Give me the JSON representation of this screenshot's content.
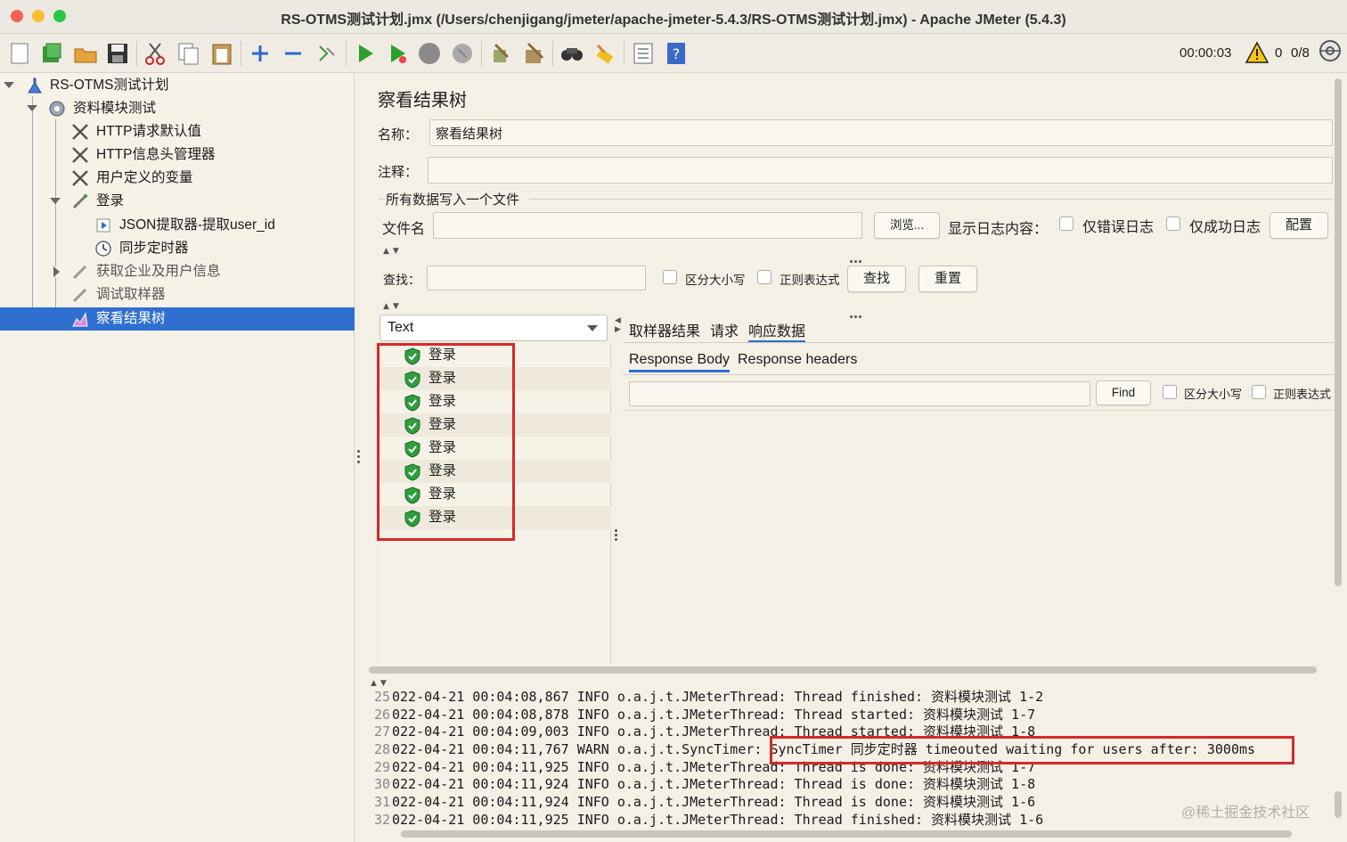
{
  "window": {
    "title": "RS-OTMS测试计划.jmx (/Users/chenjigang/jmeter/apache-jmeter-5.4.3/RS-OTMS测试计划.jmx) - Apache JMeter (5.4.3)"
  },
  "status": {
    "elapsed": "00:00:03",
    "warnings": "0",
    "threads": "0/8"
  },
  "tree": {
    "items": [
      {
        "label": "RS-OTMS测试计划",
        "icon": "test-plan-icon"
      },
      {
        "label": "资料模块测试",
        "icon": "thread-group-icon"
      },
      {
        "label": "HTTP请求默认值",
        "icon": "config-wrench-icon"
      },
      {
        "label": "HTTP信息头管理器",
        "icon": "config-wrench-icon"
      },
      {
        "label": "用户定义的变量",
        "icon": "config-wrench-icon"
      },
      {
        "label": "登录",
        "icon": "sampler-pen-icon"
      },
      {
        "label": "JSON提取器-提取user_id",
        "icon": "extractor-icon"
      },
      {
        "label": "同步定时器",
        "icon": "timer-icon"
      },
      {
        "label": "获取企业及用户信息",
        "icon": "sampler-pen-icon"
      },
      {
        "label": "调试取样器",
        "icon": "sampler-pen-icon"
      },
      {
        "label": "察看结果树",
        "icon": "listener-chart-icon"
      }
    ],
    "selected": "察看结果树"
  },
  "panel": {
    "title": "察看结果树",
    "name_label": "名称：",
    "name_value": "察看结果树",
    "comment_label": "注释：",
    "comment_value": "",
    "file_group_title": "所有数据写入一个文件",
    "filename_label": "文件名",
    "filename_value": "",
    "browse_button": "浏览...",
    "log_content_label": "显示日志内容：",
    "errors_only_label": "仅错误日志",
    "success_only_label": "仅成功日志",
    "configure_button": "配置",
    "search_label": "查找：",
    "search_value": "",
    "case_sensitive_label": "区分大小写",
    "regex_label": "正则表达式",
    "search_button": "查找",
    "reset_button": "重置",
    "renderer": "Text"
  },
  "results": {
    "items": [
      "登录",
      "登录",
      "登录",
      "登录",
      "登录",
      "登录",
      "登录",
      "登录"
    ]
  },
  "detail": {
    "tabs": [
      "取样器结果",
      "请求",
      "响应数据"
    ],
    "active_tab": "响应数据",
    "subtabs": [
      "Response Body",
      "Response headers"
    ],
    "active_subtab": "Response Body",
    "find_value": "",
    "find_button": "Find",
    "case_sensitive_label": "区分大小写",
    "regex_label": "正则表达式"
  },
  "log": {
    "lines": [
      {
        "n": "25",
        "text": "022-04-21 00:04:08,867 INFO o.a.j.t.JMeterThread: Thread finished: 资料模块测试 1-2"
      },
      {
        "n": "26",
        "text": "022-04-21 00:04:08,878 INFO o.a.j.t.JMeterThread: Thread started: 资料模块测试 1-7"
      },
      {
        "n": "27",
        "text": "022-04-21 00:04:09,003 INFO o.a.j.t.JMeterThread: Thread started: 资料模块测试 1-8"
      },
      {
        "n": "28",
        "text": "022-04-21 00:04:11,767 WARN o.a.j.t.SyncTimer: SyncTimer 同步定时器 timeouted waiting for users after: 3000ms"
      },
      {
        "n": "29",
        "text": "022-04-21 00:04:11,925 INFO o.a.j.t.JMeterThread: Thread is done: 资料模块测试 1-7"
      },
      {
        "n": "30",
        "text": "022-04-21 00:04:11,924 INFO o.a.j.t.JMeterThread: Thread is done: 资料模块测试 1-8"
      },
      {
        "n": "31",
        "text": "022-04-21 00:04:11,924 INFO o.a.j.t.JMeterThread: Thread is done: 资料模块测试 1-6"
      },
      {
        "n": "32",
        "text": "022-04-21 00:04:11,925 INFO o.a.j.t.JMeterThread: Thread finished: 资料模块测试 1-6"
      }
    ]
  },
  "watermark": "@稀土掘金技术社区",
  "colors": {
    "selection": "#2f6fd0",
    "highlight_box": "#d42a2a",
    "background": "#f5f0e6",
    "success_shield": "#2e9e3e"
  },
  "toolbar": {
    "icons": [
      "new-icon",
      "templates-icon",
      "open-icon",
      "save-icon",
      "cut-icon",
      "copy-icon",
      "paste-icon",
      "expand-icon",
      "collapse-icon",
      "toggle-icon",
      "start-icon",
      "start-no-pause-icon",
      "stop-icon",
      "shutdown-icon",
      "clear-icon",
      "clear-all-icon",
      "search-icon",
      "reset-search-icon",
      "function-helper-icon",
      "help-icon"
    ]
  }
}
